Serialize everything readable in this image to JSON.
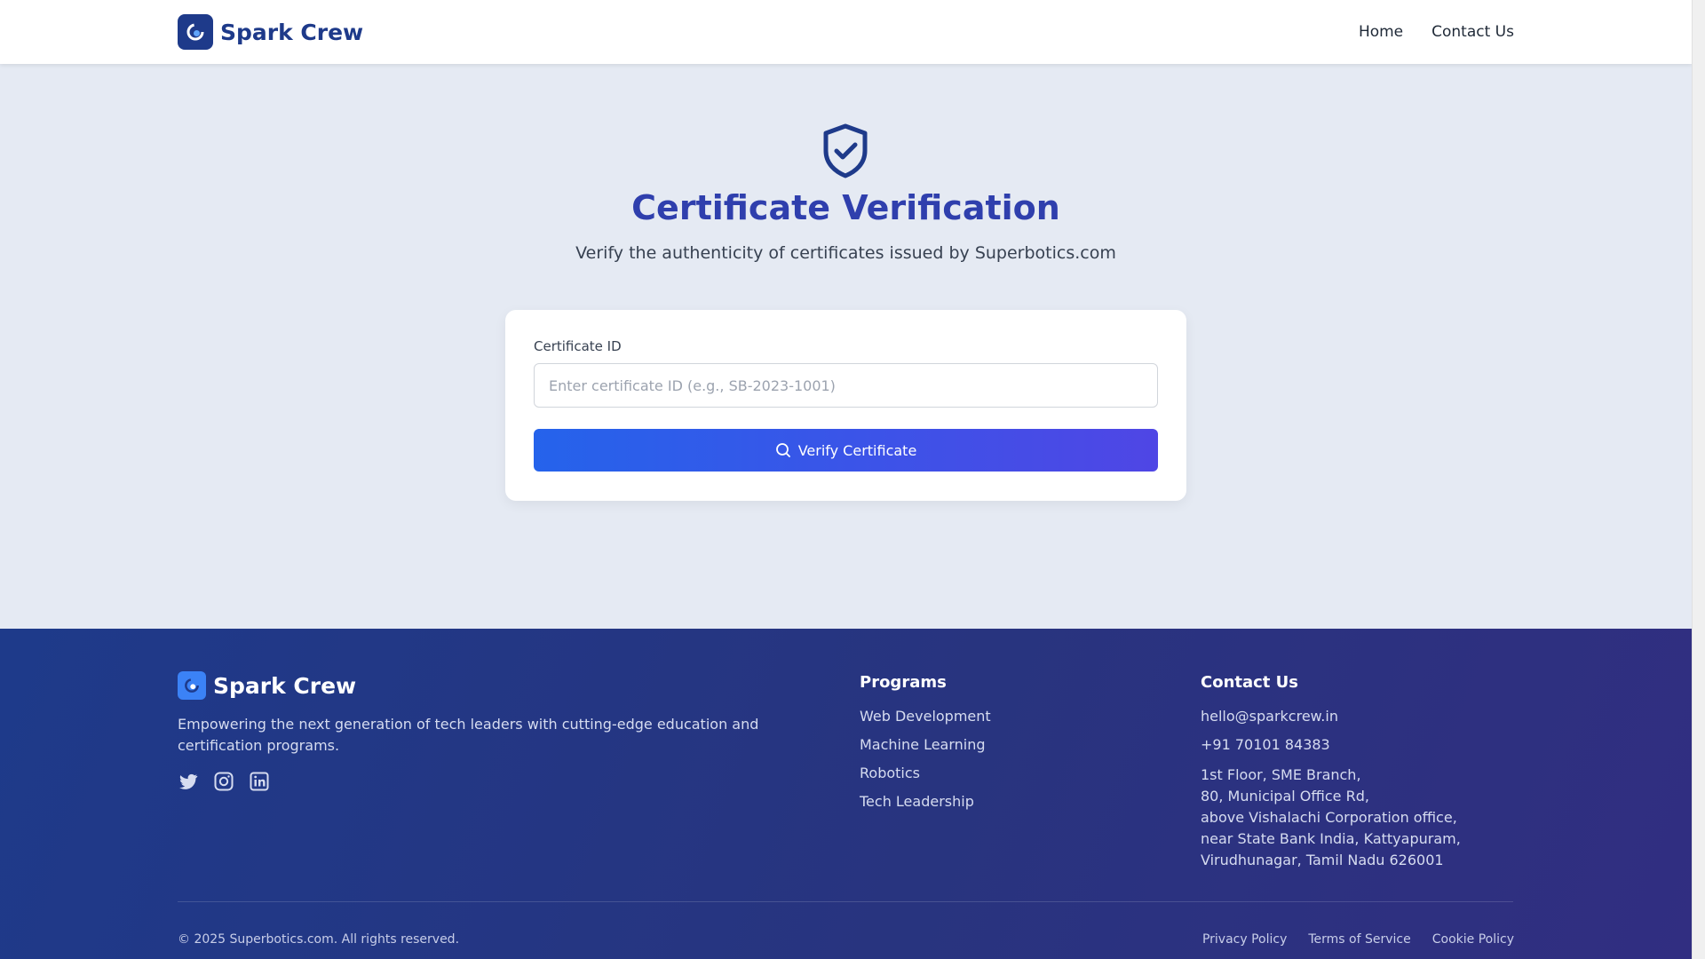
{
  "header": {
    "brand": "Spark Crew",
    "nav": [
      {
        "label": "Home"
      },
      {
        "label": "Contact Us"
      }
    ]
  },
  "hero": {
    "title": "Certificate Verification",
    "subtitle": "Verify the authenticity of certificates issued by Superbotics.com",
    "icon": "shield-check-icon"
  },
  "form": {
    "label": "Certificate ID",
    "value": "",
    "placeholder": "Enter certificate ID (e.g., SB-2023-1001)",
    "button_label": "Verify Certificate",
    "button_icon": "search-icon"
  },
  "footer": {
    "brand": "Spark Crew",
    "description": "Empowering the next generation of tech leaders with cutting-edge education and certification programs.",
    "social": [
      "twitter-icon",
      "instagram-icon",
      "linkedin-icon"
    ],
    "programs": {
      "heading": "Programs",
      "items": [
        "Web Development",
        "Machine Learning",
        "Robotics",
        "Tech Leadership"
      ]
    },
    "contact": {
      "heading": "Contact Us",
      "email": "hello@sparkcrew.in",
      "phone": "+91 70101 84383",
      "address": [
        "1st Floor, SME Branch,",
        "80, Municipal Office Rd,",
        "above Vishalachi Corporation office,",
        "near State Bank India, Kattyapuram,",
        "Virudhunagar, Tamil Nadu 626001"
      ]
    },
    "copyright": "© 2025 Superbotics.com. All rights reserved.",
    "legal": [
      "Privacy Policy",
      "Terms of Service",
      "Cookie Policy"
    ]
  },
  "colors": {
    "primary": "#1e3a8a",
    "accent": "#2563eb",
    "title": "#2f3fad"
  }
}
